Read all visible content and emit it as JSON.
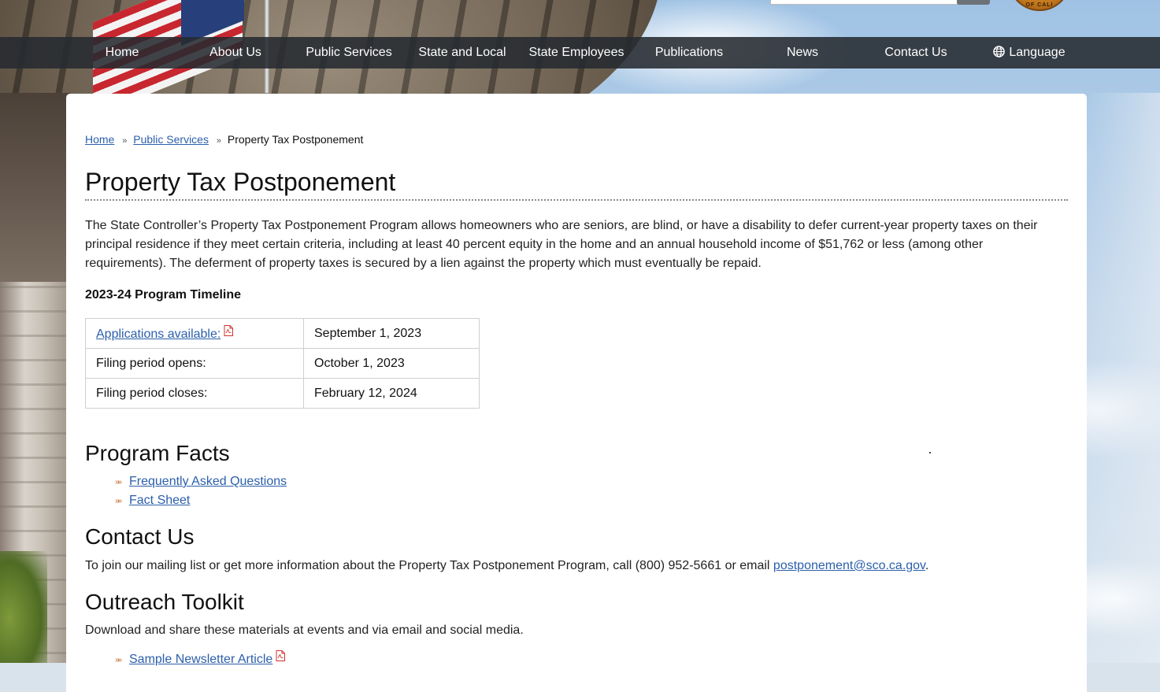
{
  "nav": {
    "items": [
      {
        "label": "Home"
      },
      {
        "label": "About Us"
      },
      {
        "label": "Public Services"
      },
      {
        "label": "State and Local"
      },
      {
        "label": "State Employees"
      },
      {
        "label": "Publications"
      },
      {
        "label": "News"
      },
      {
        "label": "Contact Us"
      },
      {
        "label": "Language",
        "icon": "globe-icon"
      }
    ]
  },
  "header": {
    "seal_text": "OF CALI"
  },
  "breadcrumb": {
    "items": [
      "Home",
      "Public Services"
    ],
    "separator": "»",
    "current": "Property Tax Postponement"
  },
  "page": {
    "title": "Property Tax Postponement",
    "intro": "The State Controller’s Property Tax Postponement Program allows homeowners who are seniors, are blind, or have a disability to defer current-year property taxes on their principal residence if they meet certain criteria, including at least 40 percent equity in the home and an annual household income of $51,762 or less (among other requirements). The deferment of property taxes is secured by a lien against the property which must eventually be repaid.",
    "timeline_heading": "2023-24 Program Timeline",
    "timeline": [
      {
        "label": "Applications available:",
        "value": "September 1, 2023",
        "is_link": true,
        "icon": "pdf-icon"
      },
      {
        "label": "Filing period opens:",
        "value": "October 1, 2023",
        "is_link": false
      },
      {
        "label": "Filing period closes:",
        "value": "February 12, 2024",
        "is_link": false
      }
    ]
  },
  "program_facts": {
    "heading": "Program Facts",
    "links": [
      "Frequently Asked Questions",
      "Fact Sheet "
    ]
  },
  "contact": {
    "heading": "Contact Us",
    "text": "To join our mailing list or get more information about the Property Tax Postponement Program, call (800) 952-5661 or email ",
    "email": "postponement@sco.ca.gov",
    "trailing": "."
  },
  "outreach": {
    "heading": "Outreach Toolkit",
    "text": "Download and share these materials at events and via email and social media.",
    "links": [
      {
        "label": "Sample Newsletter Article",
        "icon": "pdf-icon"
      }
    ]
  },
  "colors": {
    "link": "#2b5faa",
    "nav_bg": "#262a30",
    "bullet": "#c0692a",
    "pdf_icon": "#d0312d"
  }
}
